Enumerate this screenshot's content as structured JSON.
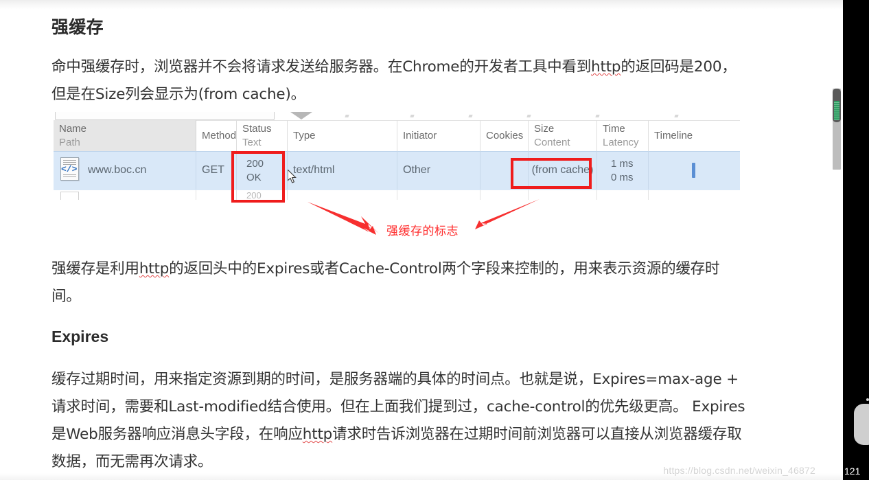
{
  "article": {
    "section_title": "强缓存",
    "paragraph_1_part1": "命中强缓存时，浏览器并不会将请求发送给服务器。在Chrome的开发者工具中看到",
    "paragraph_1_link": "http",
    "paragraph_1_part2": "的返回码是200，但是在Size列会显示为(from cache)。",
    "paragraph_2_part1": "强缓存是利用",
    "paragraph_2_link": "http",
    "paragraph_2_part2": "的返回头中的Expires或者Cache-Control两个字段来控制的，用来表示资源的缓存时间。",
    "expires_title": "Expires",
    "paragraph_3_part1": "缓存过期时间，用来指定资源到期的时间，是服务器端的具体的时间点。也就是说，Expires=max-age + 请求时间，需要和Last-modified结合使用。但在上面我们提到过，cache-control的优先级更高。 Expires是Web服务器响应消息头字段，在响应",
    "paragraph_3_link": "http",
    "paragraph_3_part2": "请求时告诉浏览器在过期时间前浏览器可以直接从浏览器缓存取数据，而无需再次请求。"
  },
  "devtools": {
    "columns": [
      {
        "title": "Name",
        "subtitle": "Path"
      },
      {
        "title": "Method",
        "subtitle": ""
      },
      {
        "title": "Status",
        "subtitle": "Text"
      },
      {
        "title": "Type",
        "subtitle": ""
      },
      {
        "title": "Initiator",
        "subtitle": ""
      },
      {
        "title": "Cookies",
        "subtitle": ""
      },
      {
        "title": "Size",
        "subtitle": "Content"
      },
      {
        "title": "Time",
        "subtitle": "Latency"
      },
      {
        "title": "Timeline",
        "subtitle": ""
      }
    ],
    "row": {
      "name": "www.boc.cn",
      "method": "GET",
      "status": "200",
      "status_text": "OK",
      "type": "text/html",
      "initiator": "Other",
      "cookies": "",
      "size": "(from cache)",
      "time": "1 ms",
      "latency": "0 ms"
    },
    "partial_row": {
      "status": "200"
    }
  },
  "annotation": {
    "caption": "强缓存的标志",
    "color": "#ff2d2d",
    "box_color": "#ef1c1c"
  },
  "watermark": {
    "text": "https://blog.csdn.net/weixin_46872",
    "tail": "121"
  }
}
